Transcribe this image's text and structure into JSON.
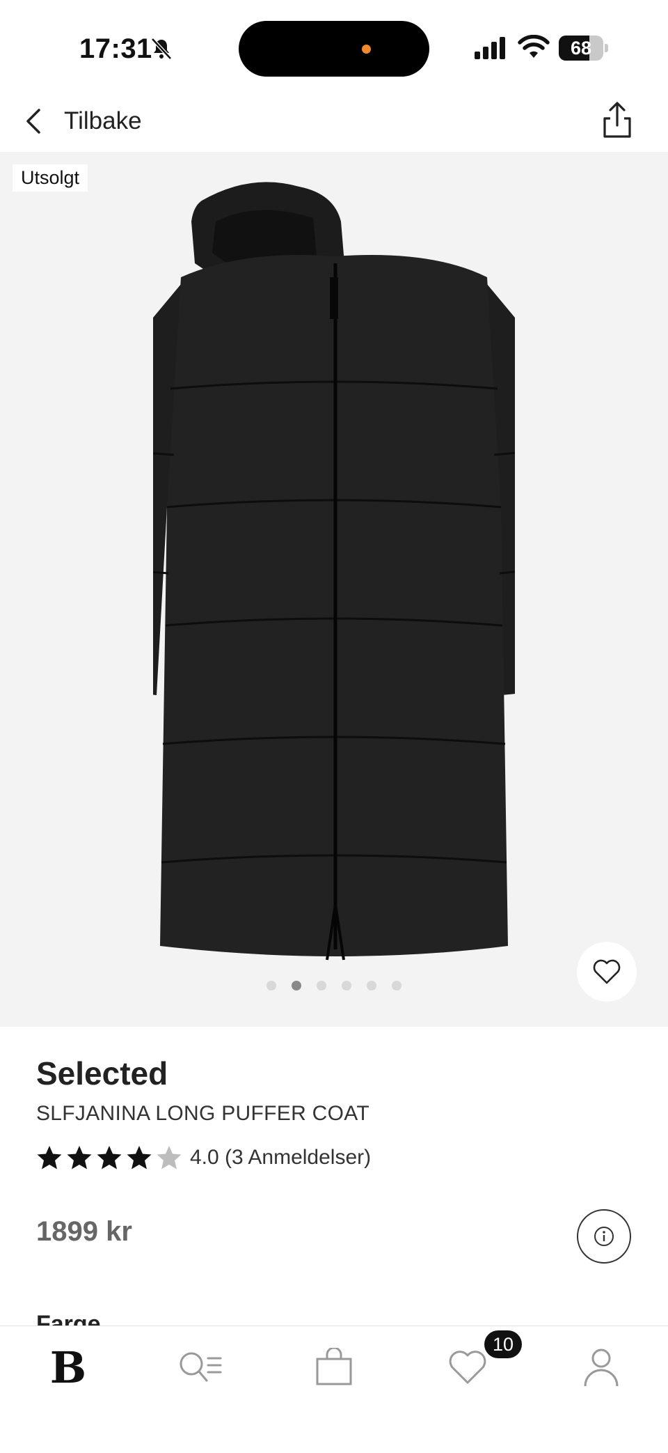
{
  "status_bar": {
    "time": "17:31",
    "battery": "68",
    "battery_level": 0.68,
    "icons": [
      "bell-muted-icon",
      "cellular-signal-icon",
      "wifi-icon",
      "battery-icon"
    ]
  },
  "nav": {
    "back_label": "Tilbake",
    "back_icon": "chevron-left-icon",
    "share_icon": "share-icon"
  },
  "product_image": {
    "badge": "Utsolgt",
    "dot_count": 6,
    "active_dot": 1,
    "favorite_icon": "heart-outline-icon"
  },
  "product": {
    "brand": "Selected",
    "name": "SLFJANINA LONG PUFFER COAT",
    "rating_value": 4.0,
    "stars_total": 5,
    "rating_text": "4.0 (3 Anmeldelser)",
    "price": "1899 kr",
    "info_icon": "info-icon",
    "next_section": "Farge"
  },
  "tabbar": {
    "home_logo": "B",
    "search_icon": "search-list-icon",
    "bag_icon": "shopping-bag-icon",
    "favorites_icon": "heart-icon",
    "favorites_badge": "10",
    "profile_icon": "profile-icon"
  },
  "colors": {
    "accent_dot": "#f08a2c",
    "image_background": "#f3f3f3",
    "text_primary": "#222222",
    "price": "#666666"
  }
}
